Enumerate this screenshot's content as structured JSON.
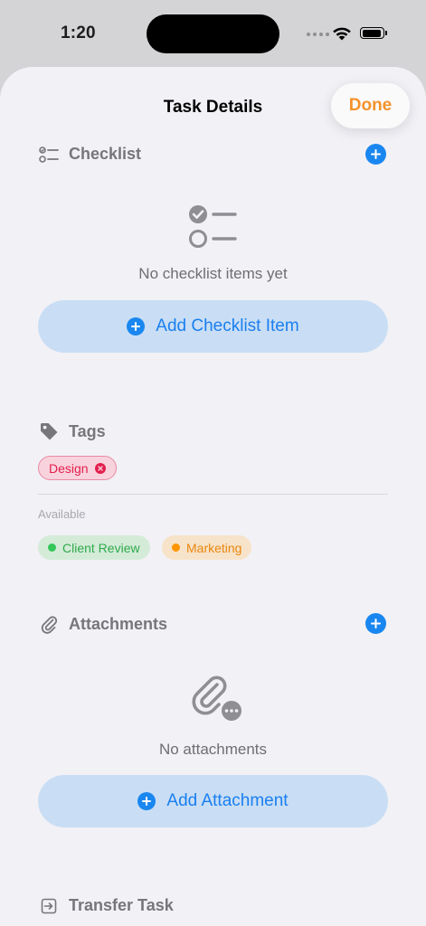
{
  "status_bar": {
    "time": "1:20"
  },
  "header": {
    "title": "Task Details",
    "done_label": "Done"
  },
  "checklist": {
    "title": "Checklist",
    "empty_text": "No checklist items yet",
    "add_label": "Add Checklist Item"
  },
  "tags": {
    "title": "Tags",
    "selected": [
      {
        "label": "Design",
        "color": "#e21e4d"
      }
    ],
    "available_label": "Available",
    "available": [
      {
        "label": "Client Review",
        "color": "#34c759"
      },
      {
        "label": "Marketing",
        "color": "#ff9500"
      }
    ]
  },
  "attachments": {
    "title": "Attachments",
    "empty_text": "No attachments",
    "add_label": "Add Attachment"
  },
  "transfer": {
    "title": "Transfer Task"
  },
  "colors": {
    "accent_blue": "#1a87f0",
    "done_orange": "#f4922c"
  }
}
